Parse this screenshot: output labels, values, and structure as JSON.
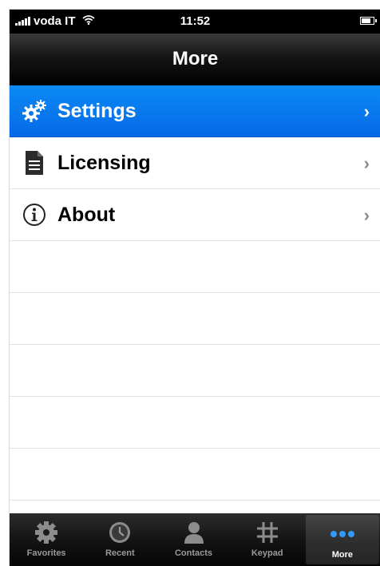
{
  "status_bar": {
    "carrier": "voda IT",
    "time": "11:52",
    "battery_level": 0.8
  },
  "nav": {
    "title": "More"
  },
  "menu": {
    "items": [
      {
        "label": "Settings",
        "icon": "gears-icon",
        "selected": true
      },
      {
        "label": "Licensing",
        "icon": "document-icon",
        "selected": false
      },
      {
        "label": "About",
        "icon": "info-icon",
        "selected": false
      }
    ]
  },
  "tabbar": {
    "items": [
      {
        "label": "Favorites",
        "icon": "gear-icon"
      },
      {
        "label": "Recent",
        "icon": "clock-icon"
      },
      {
        "label": "Contacts",
        "icon": "person-icon"
      },
      {
        "label": "Keypad",
        "icon": "hash-icon"
      },
      {
        "label": "More",
        "icon": "dots-icon",
        "active": true
      }
    ]
  },
  "colors": {
    "selection_blue": "#0a7df2",
    "bar_black": "#000000"
  }
}
